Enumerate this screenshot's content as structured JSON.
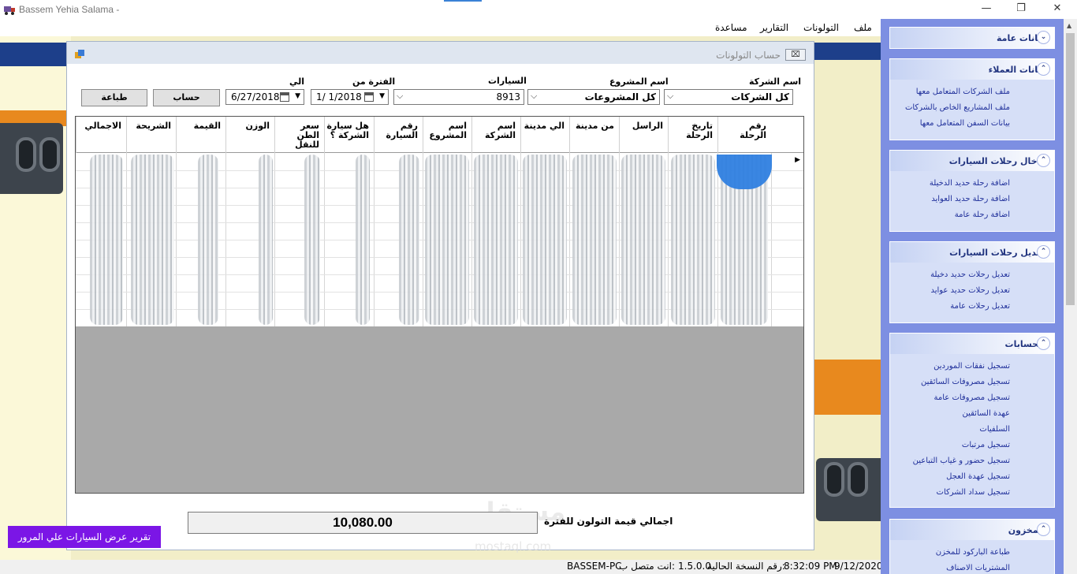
{
  "window": {
    "title": "Bassem Yehia Salama -",
    "minimize_glyph": "—",
    "restore_glyph": "❐",
    "close_glyph": "✕"
  },
  "menu": [
    "ملف",
    "التولونات",
    "التقارير",
    "مساعدة"
  ],
  "child_window": {
    "title": "حساب التولونات",
    "close_glyph": "⌧"
  },
  "form": {
    "company_label": "اسم الشركة",
    "company_value": "كل الشركات",
    "project_label": "اسم المشروع",
    "project_value": "كل المشروعات",
    "cars_label": "السيارات",
    "cars_value": "8913",
    "period_from_label": "الفترة من",
    "period_from_value": "1/  1/2018",
    "to_label": "الي",
    "to_value": "6/27/2018",
    "calc_button": "حساب",
    "print_button": "طباعة"
  },
  "grid": {
    "columns": [
      "رقم الرحلة",
      "تاريخ الرحلة",
      "الراسل",
      "من مدينة",
      "الي مدينة",
      "اسم الشركة",
      "اسم المشروع",
      "رقم السيارة",
      "هل سيارة الشركة ؟",
      "سعر الطن للنقل",
      "الوزن",
      "القيمة",
      "الشريحة",
      "الاجمالي"
    ],
    "row_indicator": "▶"
  },
  "totals": {
    "label": "اجمالي قيمة التولون للفترة",
    "value": "10,080.00"
  },
  "watermark": {
    "text": "مستقل",
    "sub": "mostaql.com"
  },
  "report_button": "تقرير عرض السيارات علي المرور",
  "statusbar": {
    "date": "9/12/2020",
    "time": "8:32:09 PM",
    "version_label": "رقم النسخة الحالية:",
    "version": "1.5.0.0",
    "connected_label": "انت متصل ب:",
    "machine": "BASSEM-PC"
  },
  "nav": [
    {
      "title": "بيانات عامة",
      "toggle": "⌄",
      "items": []
    },
    {
      "title": "بيانات العملاء",
      "toggle": "⌃",
      "items": [
        "ملف الشركات المتعامل معها",
        "ملف المشاريع الخاص بالشركات",
        "بيانات السفن المتعامل معها"
      ]
    },
    {
      "title": "ادخال رحلات السيارات",
      "toggle": "⌃",
      "items": [
        "اضافة رحلة حديد الدخيلة",
        "اضافة رحلة حديد العوايد",
        "اضافة رحلة عامة"
      ]
    },
    {
      "title": "تعديل رحلات السيارات",
      "toggle": "⌃",
      "items": [
        "تعديل رحلات حديد دخيلة",
        "تعديل رحلات حديد عوايد",
        "تعديل رحلات عامة"
      ]
    },
    {
      "title": "الحسابات",
      "toggle": "⌃",
      "items": [
        "تسجيل نفقات الموردين",
        "تسجيل مصروفات السائقين",
        "تسجيل مصروفات عامة",
        "عهدة السائقين",
        "السلفيات",
        "تسجيل مرتبات",
        "تسجيل حضور و غياب التباعين",
        "تسجيل عهدة العجل",
        "تسجيل سداد الشركات"
      ]
    },
    {
      "title": "المخزون",
      "toggle": "⌃",
      "items": [
        "طباعة الباركود للمخزن",
        "المشتريات الاصناف"
      ]
    }
  ],
  "colors": {
    "nav_bg": "#7d8fe2",
    "report_button": "#7b16e6",
    "grid_empty": "#a9a9a9"
  }
}
